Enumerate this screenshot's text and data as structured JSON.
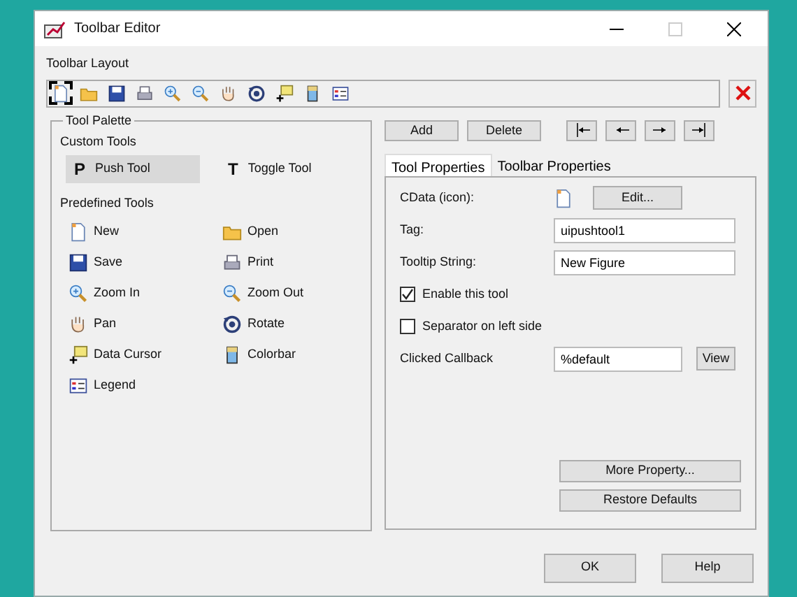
{
  "window": {
    "title": "Toolbar Editor"
  },
  "toolbar_layout": {
    "label": "Toolbar Layout",
    "items": [
      {
        "selected": true
      },
      {
        "selected": false
      },
      {
        "selected": false
      },
      {
        "selected": false
      },
      {
        "selected": false
      },
      {
        "selected": false
      },
      {
        "selected": false
      },
      {
        "selected": false
      },
      {
        "selected": false
      },
      {
        "selected": false
      },
      {
        "selected": false
      }
    ]
  },
  "tool_palette": {
    "title": "Tool Palette",
    "custom_heading": "Custom Tools",
    "custom_tools": [
      {
        "glyph": "P",
        "label": "Push Tool",
        "selected": true
      },
      {
        "glyph": "T",
        "label": "Toggle Tool",
        "selected": false
      }
    ],
    "predefined_heading": "Predefined Tools",
    "predefined_tools": [
      {
        "label": "New"
      },
      {
        "label": "Open"
      },
      {
        "label": "Save"
      },
      {
        "label": "Print"
      },
      {
        "label": "Zoom In"
      },
      {
        "label": "Zoom Out"
      },
      {
        "label": "Pan"
      },
      {
        "label": "Rotate"
      },
      {
        "label": "Data Cursor"
      },
      {
        "label": "Colorbar"
      },
      {
        "label": "Legend"
      }
    ]
  },
  "actions": [
    "Add",
    "Delete"
  ],
  "tabs": [
    {
      "label": "Tool Properties",
      "selected": true
    },
    {
      "label": "Toolbar Properties",
      "selected": false
    }
  ],
  "properties": {
    "cdata_label": "CData (icon):",
    "edit_button": "Edit...",
    "tag_label": "Tag:",
    "tag_value": "uipushtool1",
    "tooltip_label": "Tooltip String:",
    "tooltip_value": "New Figure",
    "options": [
      {
        "label": "Enable this tool",
        "checked": true
      },
      {
        "label": "Separator on left side",
        "checked": false
      }
    ],
    "callback_label": "Clicked Callback",
    "callback_value": "%default",
    "view_button": "View",
    "more_button": "More Property...",
    "restore_button": "Restore Defaults"
  },
  "buttons": [
    "OK",
    "Help"
  ]
}
